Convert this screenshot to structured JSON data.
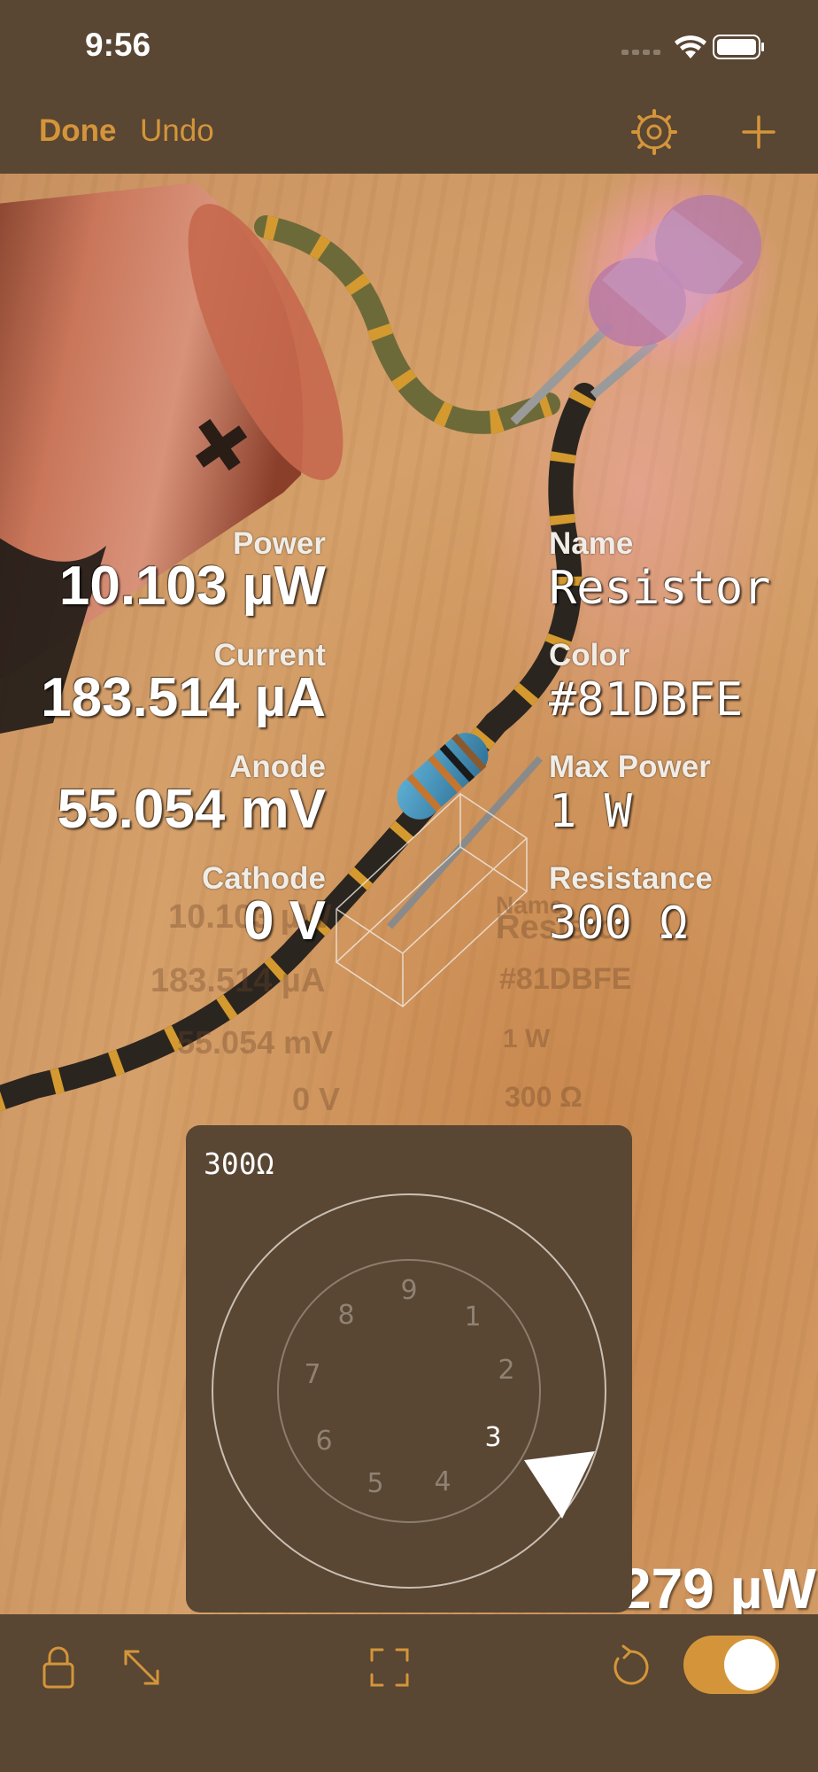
{
  "status": {
    "time": "9:56"
  },
  "nav": {
    "done_label": "Done",
    "undo_label": "Undo"
  },
  "info_left": {
    "power_label": "Power",
    "power_value": "10.103 µW",
    "current_label": "Current",
    "current_value": "183.514 µA",
    "anode_label": "Anode",
    "anode_value": "55.054 mV",
    "cathode_label": "Cathode",
    "cathode_value": "0 V"
  },
  "info_right": {
    "name_label": "Name",
    "name_value": "Resistor",
    "color_label": "Color",
    "color_value": "#81DBFE",
    "maxpower_label": "Max Power",
    "maxpower_value": "1 W",
    "resistance_label": "Resistance",
    "resistance_value": "300 Ω"
  },
  "dial": {
    "value_label": "300Ω",
    "digits": [
      "9",
      "1",
      "2",
      "3",
      "4",
      "5",
      "6",
      "7",
      "8"
    ],
    "selected_digit": "3"
  },
  "corner_power": "279 µW",
  "toolbar": {
    "toggle_on": true
  },
  "colors": {
    "accent": "#d4953a",
    "panel": "#594633",
    "resistor_body": "#81DBFE"
  },
  "icons": [
    "wifi-icon",
    "battery-icon",
    "gear-icon",
    "plus-icon",
    "lock-icon",
    "expand-icon",
    "focus-frame-icon",
    "rotate-icon"
  ]
}
